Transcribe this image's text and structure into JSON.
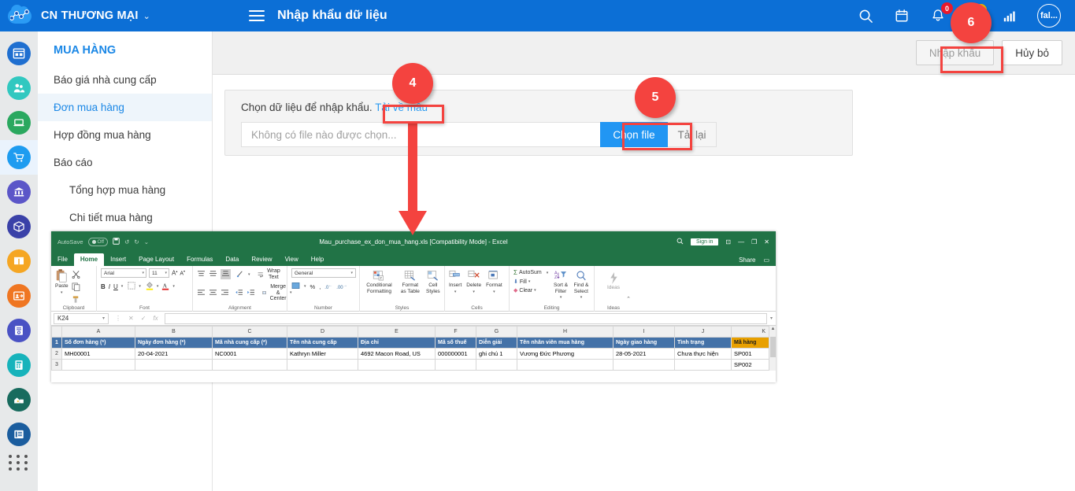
{
  "topbar": {
    "org_name": "CN THƯƠNG MẠI",
    "caret": "⌄",
    "page_title": "Nhập khẩu dữ liệu",
    "icons": {
      "search": "search-icon",
      "calendar": "calendar-icon",
      "bell": "bell-icon",
      "chart": "bar-chart-icon"
    },
    "bell_badge": "0",
    "second_badge": "0",
    "avatar_text": "fal...",
    "bg_color": "#0C6FD6"
  },
  "rail": {
    "items": [
      {
        "name": "dashboard",
        "color": "#1f6fd0"
      },
      {
        "name": "contacts",
        "color": "#31c8c0"
      },
      {
        "name": "sales",
        "color": "#2aa85f"
      },
      {
        "name": "purchasing",
        "color": "#1e9cf0",
        "active": true
      },
      {
        "name": "bank",
        "color": "#5b56c8"
      },
      {
        "name": "inventory",
        "color": "#3a41a8"
      },
      {
        "name": "products",
        "color": "#f5a623"
      },
      {
        "name": "hr",
        "color": "#ef7622"
      },
      {
        "name": "invoice",
        "color": "#4a52c4"
      },
      {
        "name": "accounting",
        "color": "#17b3bb"
      },
      {
        "name": "assets",
        "color": "#186b5e"
      },
      {
        "name": "documents",
        "color": "#1b5d9e"
      }
    ]
  },
  "sidemenu": {
    "heading": "MUA HÀNG",
    "items": [
      {
        "label": "Báo giá nhà cung cấp",
        "sub": false,
        "active": false
      },
      {
        "label": "Đơn mua hàng",
        "sub": false,
        "active": true
      },
      {
        "label": "Hợp đồng mua hàng",
        "sub": false,
        "active": false
      },
      {
        "label": "Báo cáo",
        "sub": false,
        "active": false
      },
      {
        "label": "Tổng hợp mua hàng",
        "sub": true,
        "active": false
      },
      {
        "label": "Chi tiết mua hàng",
        "sub": true,
        "active": false
      }
    ]
  },
  "actions": {
    "import_label": "Nhập khẩu",
    "cancel_label": "Hủy bỏ"
  },
  "import_panel": {
    "prompt": "Chọn dữ liệu để nhập khẩu.",
    "template_link": "Tải về mẫu",
    "file_placeholder": "Không có file nào được chọn...",
    "choose_label": "Chọn file",
    "reload_label": "Tải lại",
    "choose_color": "#2196f3"
  },
  "annotations": {
    "marker_4": "4",
    "marker_5": "5",
    "marker_6": "6",
    "color": "#f4433f"
  },
  "excel": {
    "autosave_label": "AutoSave",
    "autosave_state": "Off",
    "doc_title": "Mau_purchase_ex_don_mua_hang.xls  [Compatibility Mode]  -  Excel",
    "signin_label": "Sign in",
    "tabs": [
      "File",
      "Home",
      "Insert",
      "Page Layout",
      "Formulas",
      "Data",
      "Review",
      "View",
      "Help"
    ],
    "active_tab": "Home",
    "share_label": "Share",
    "ribbon": {
      "clipboard": {
        "label": "Clipboard",
        "paste": "Paste"
      },
      "font": {
        "label": "Font",
        "font_name": "Arial",
        "font_size": "11",
        "bold": "B",
        "italic": "I",
        "underline": "U"
      },
      "alignment": {
        "label": "Alignment",
        "wrap": "Wrap Text",
        "merge": "Merge & Center"
      },
      "number": {
        "label": "Number",
        "format": "General",
        "percent": "%",
        "comma": ","
      },
      "styles": {
        "label": "Styles",
        "conditional": "Conditional Formatting",
        "table": "Format as Table",
        "cell": "Cell Styles"
      },
      "cells": {
        "label": "Cells",
        "insert": "Insert",
        "delete": "Delete",
        "format": "Format"
      },
      "editing": {
        "label": "Editing",
        "autosum": "AutoSum",
        "fill": "Fill",
        "clear": "Clear",
        "sort": "Sort & Filter",
        "find": "Find & Select"
      },
      "ideas": {
        "label": "Ideas",
        "button": "Ideas"
      }
    },
    "namebox": "K24",
    "formula_value": "",
    "columns": [
      "A",
      "B",
      "C",
      "D",
      "E",
      "F",
      "G",
      "H",
      "I",
      "J",
      "K"
    ],
    "rows": [
      "1",
      "2",
      "3"
    ],
    "header_row": [
      {
        "text": "Số đơn hàng (*)",
        "highlight": false
      },
      {
        "text": "Ngày đơn hàng (*)",
        "highlight": false
      },
      {
        "text": "Mã nhà cung cấp (*)",
        "highlight": false
      },
      {
        "text": "Tên nhà cung cấp",
        "highlight": false
      },
      {
        "text": "Địa chỉ",
        "highlight": false
      },
      {
        "text": "Mã số thuế",
        "highlight": false
      },
      {
        "text": "Diễn giải",
        "highlight": false
      },
      {
        "text": "Tên nhân viên mua hàng",
        "highlight": false
      },
      {
        "text": "Ngày giao hàng",
        "highlight": false
      },
      {
        "text": "Tình trạng",
        "highlight": false
      },
      {
        "text": "Mã hàng",
        "highlight": true
      }
    ],
    "data_rows": [
      [
        "MH00001",
        "20-04-2021",
        "NC0001",
        "Kathryn Miller",
        "4692 Macon Road, US",
        "000000001",
        "ghi chú 1",
        "Vương Đức Phương",
        "28-05-2021",
        "Chưa thực hiện",
        "SP001"
      ],
      [
        "",
        "",
        "",
        "",
        "",
        "",
        "",
        "",
        "",
        "",
        "SP002"
      ]
    ]
  }
}
